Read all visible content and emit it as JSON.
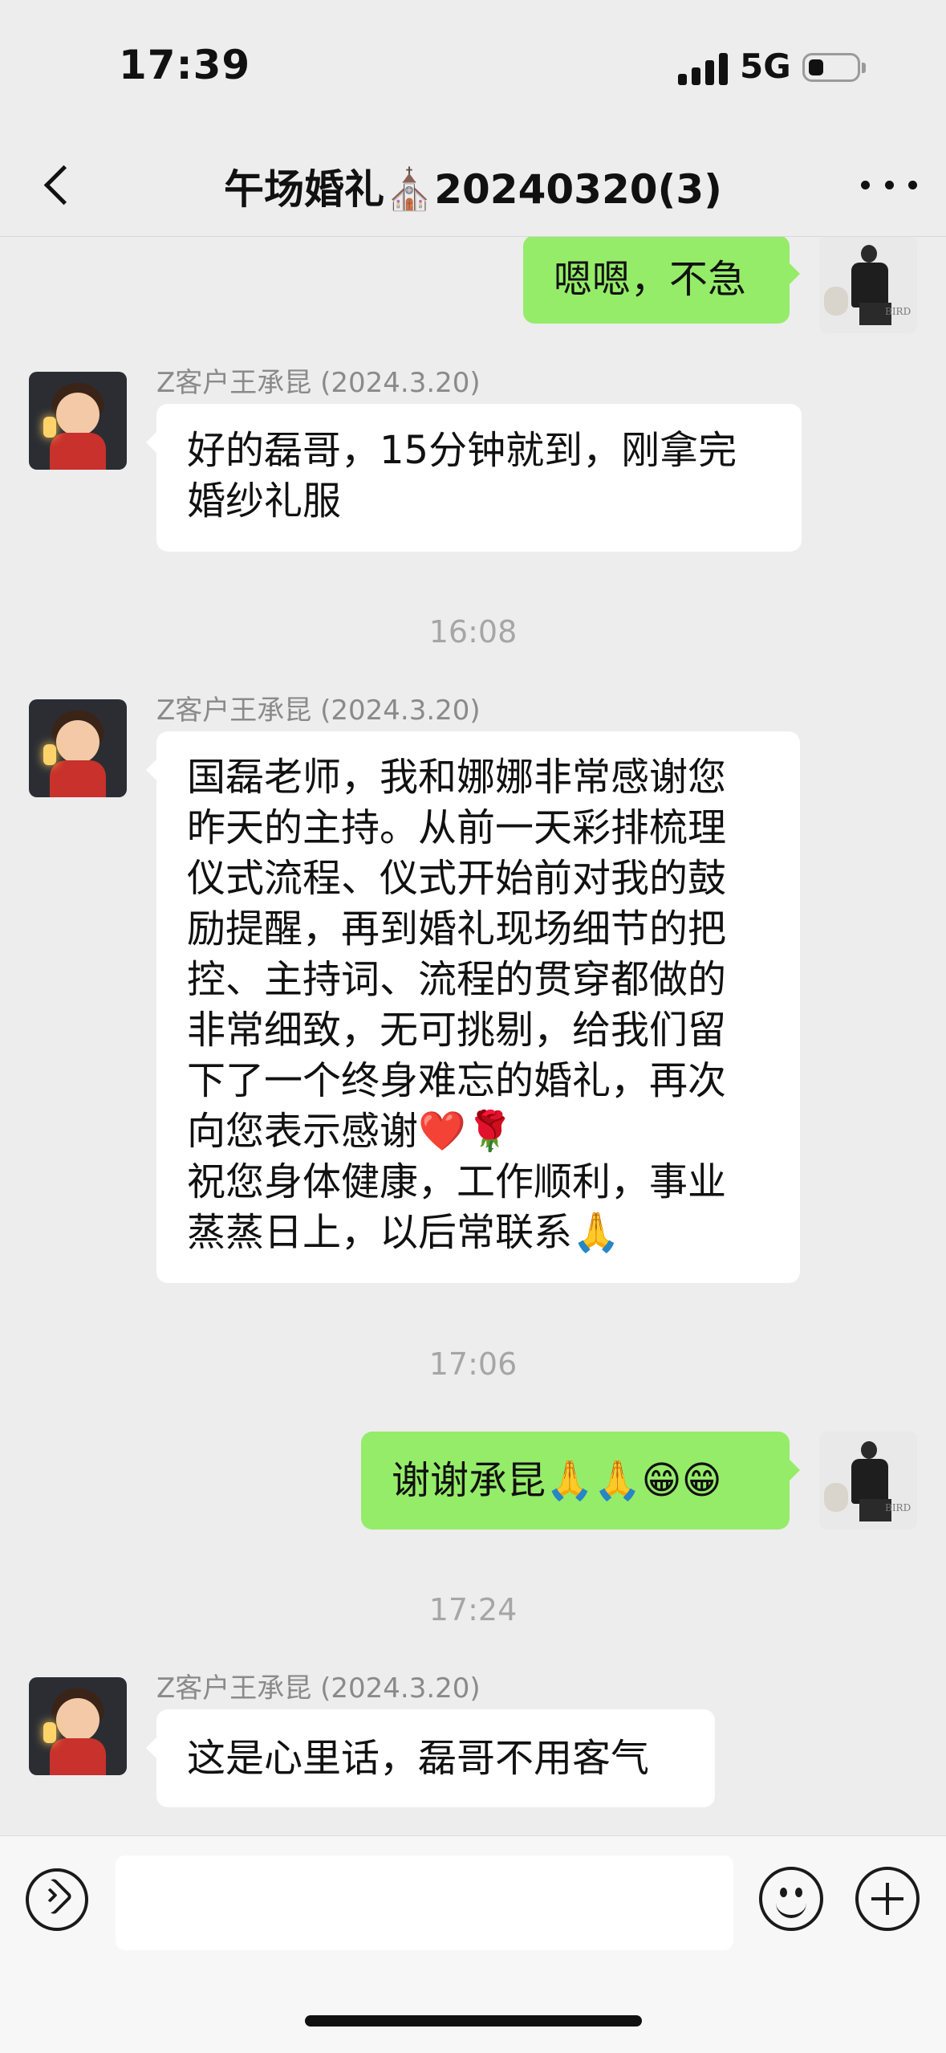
{
  "status": {
    "time": "17:39",
    "network": "5G"
  },
  "nav": {
    "title": "午场婚礼⛪20240320(3)"
  },
  "messages": [
    {
      "sender": "",
      "text": "嗯嗯，不急"
    },
    {
      "sender": "Z客户王承昆 (2024.3.20)",
      "lines": [
        "好的磊哥，15分钟就到，刚拿完",
        "婚纱礼服"
      ]
    },
    {
      "time": "16:08"
    },
    {
      "sender": "Z客户王承昆 (2024.3.20)",
      "lines": [
        "国磊老师，我和娜娜非常感谢您",
        "昨天的主持。从前一天彩排梳理",
        "仪式流程、仪式开始前对我的鼓",
        "励提醒，再到婚礼现场细节的把",
        "控、主持词、流程的贯穿都做的",
        "非常细致，无可挑剔，给我们留",
        "下了一个终身难忘的婚礼，再次",
        "向您表示感谢❤️🌹",
        "祝您身体健康，工作顺利，事业",
        "蒸蒸日上，以后常联系🙏"
      ]
    },
    {
      "time": "17:06"
    },
    {
      "sender": "",
      "text": "谢谢承昆🙏🙏😁😁"
    },
    {
      "time": "17:24"
    },
    {
      "sender": "Z客户王承昆 (2024.3.20)",
      "text": "这是心里话，磊哥不用客气"
    }
  ],
  "input": {
    "placeholder": ""
  }
}
